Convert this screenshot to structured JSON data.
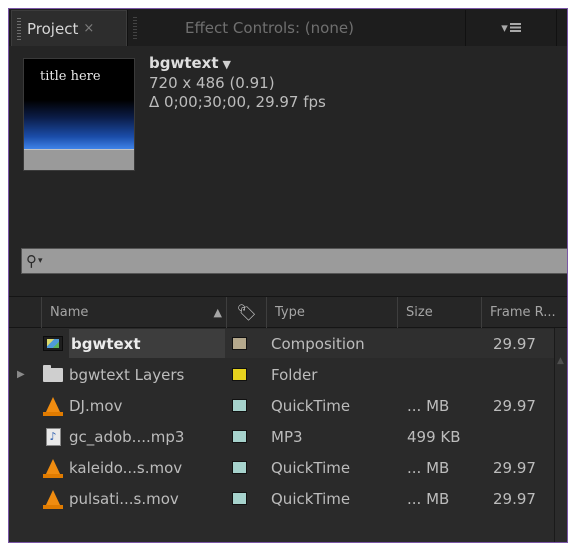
{
  "tabs": {
    "project": {
      "label": "Project",
      "close": "×"
    },
    "effect_controls": {
      "label": "Effect Controls: (none)"
    }
  },
  "preview": {
    "thumbnail_text": "title here",
    "name": "bgwtext",
    "caret": "▼",
    "dimensions": "720 x 486 (0.91)",
    "duration": "Δ 0;00;30;00, 29.97 fps"
  },
  "search": {
    "icon": "search-icon",
    "caret": "▾"
  },
  "columns": {
    "name": "Name",
    "sort": "▲",
    "type": "Type",
    "size": "Size",
    "rate": "Frame R..."
  },
  "items": [
    {
      "name": "bgwtext",
      "icon": "composition-icon",
      "label_color": "#b4a88c",
      "type": "Composition",
      "size": "",
      "rate": "29.97",
      "selected": true
    },
    {
      "name": "bgwtext Layers",
      "icon": "folder-icon",
      "label_color": "#e6d21e",
      "type": "Folder",
      "size": "",
      "rate": "",
      "expander": "▶"
    },
    {
      "name": "DJ.mov",
      "icon": "vlc-cone-icon",
      "label_color": "#a6d2cc",
      "type": "QuickTime",
      "size": "... MB",
      "rate": "29.97"
    },
    {
      "name": "gc_adob....mp3",
      "icon": "audio-file-icon",
      "label_color": "#a6d2cc",
      "type": "MP3",
      "size": "499 KB",
      "rate": ""
    },
    {
      "name": "kaleido...s.mov",
      "icon": "vlc-cone-icon",
      "label_color": "#a6d2cc",
      "type": "QuickTime",
      "size": "... MB",
      "rate": "29.97"
    },
    {
      "name": "pulsati...s.mov",
      "icon": "vlc-cone-icon",
      "label_color": "#a6d2cc",
      "type": "QuickTime",
      "size": "... MB",
      "rate": "29.97"
    }
  ],
  "colors": {
    "panel_bg": "#232323",
    "panel_border": "#7a56a6",
    "search_bg": "#9b9b9b"
  }
}
